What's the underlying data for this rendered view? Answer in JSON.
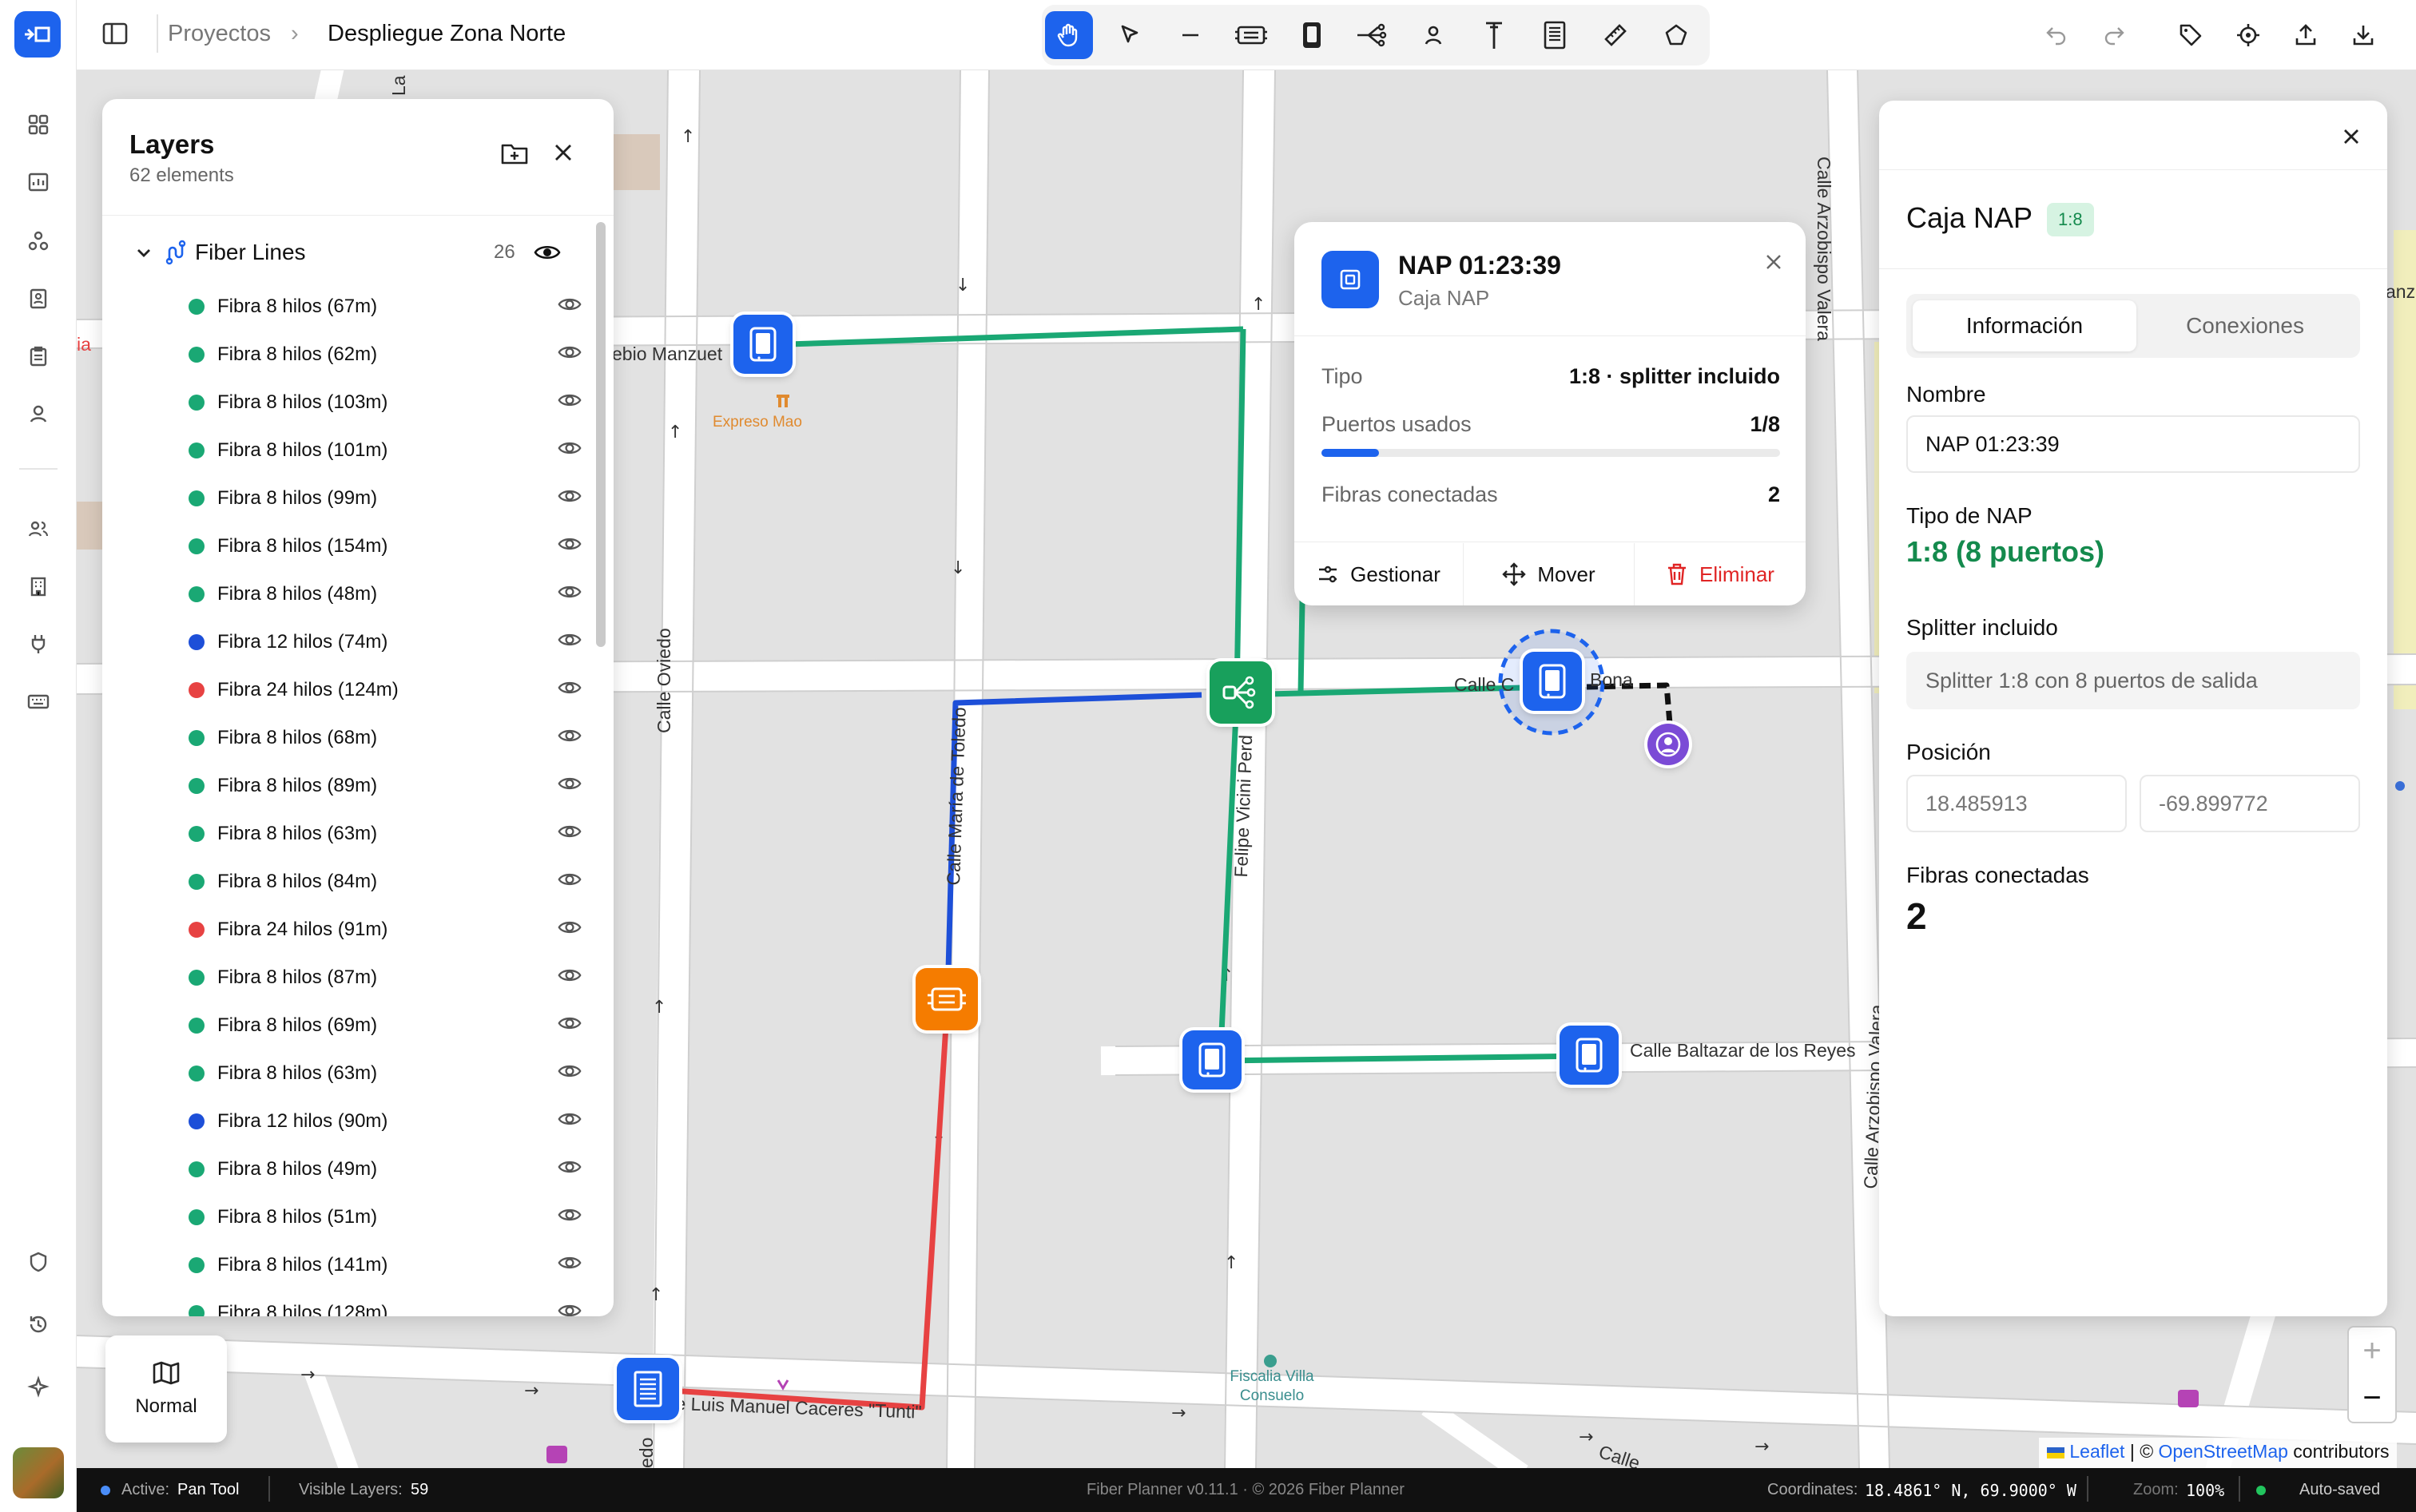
{
  "app": {
    "name": "Fiber Planner"
  },
  "breadcrumb": {
    "parent": "Proyectos",
    "current": "Despliegue Zona Norte"
  },
  "colors": {
    "accent": "#1d63ed",
    "fiber8": "#1aa874",
    "fiber12": "#1d4fd8",
    "fiber24": "#e74242",
    "splitter": "#18a05c",
    "olt": "#f57c00"
  },
  "sidebar": {
    "icons": [
      "dashboard-icon",
      "chart-icon",
      "network-icon",
      "contact-icon",
      "clipboard-icon",
      "user-location-icon",
      "users-icon",
      "building-icon",
      "plug-icon",
      "keyboard-icon",
      "shield-icon",
      "history-icon",
      "sparkle-icon"
    ]
  },
  "toolbar": {
    "tools": [
      "pan-hand-icon",
      "select-pointer-icon",
      "line-icon",
      "olt-icon",
      "nap-box-icon",
      "splitter-icon",
      "client-icon",
      "pole-icon",
      "cabinet-icon",
      "ruler-icon",
      "polygon-icon"
    ],
    "active": "pan-hand-icon",
    "right": [
      "undo-icon",
      "redo-icon",
      "tag-icon",
      "locate-icon",
      "upload-icon",
      "download-icon"
    ]
  },
  "layers": {
    "title": "Layers",
    "subtitle": "62 elements",
    "group": {
      "name": "Fiber Lines",
      "count": "26"
    },
    "items": [
      {
        "label": "Fibra 8 hilos (67m)",
        "color": "#1aa874"
      },
      {
        "label": "Fibra 8 hilos (62m)",
        "color": "#1aa874"
      },
      {
        "label": "Fibra 8 hilos (103m)",
        "color": "#1aa874"
      },
      {
        "label": "Fibra 8 hilos (101m)",
        "color": "#1aa874"
      },
      {
        "label": "Fibra 8 hilos (99m)",
        "color": "#1aa874"
      },
      {
        "label": "Fibra 8 hilos (154m)",
        "color": "#1aa874"
      },
      {
        "label": "Fibra 8 hilos (48m)",
        "color": "#1aa874"
      },
      {
        "label": "Fibra 12 hilos (74m)",
        "color": "#1d4fd8"
      },
      {
        "label": "Fibra 24 hilos (124m)",
        "color": "#e74242"
      },
      {
        "label": "Fibra 8 hilos (68m)",
        "color": "#1aa874"
      },
      {
        "label": "Fibra 8 hilos (89m)",
        "color": "#1aa874"
      },
      {
        "label": "Fibra 8 hilos (63m)",
        "color": "#1aa874"
      },
      {
        "label": "Fibra 8 hilos (84m)",
        "color": "#1aa874"
      },
      {
        "label": "Fibra 24 hilos (91m)",
        "color": "#e74242"
      },
      {
        "label": "Fibra 8 hilos (87m)",
        "color": "#1aa874"
      },
      {
        "label": "Fibra 8 hilos (69m)",
        "color": "#1aa874"
      },
      {
        "label": "Fibra 8 hilos (63m)",
        "color": "#1aa874"
      },
      {
        "label": "Fibra 12 hilos (90m)",
        "color": "#1d4fd8"
      },
      {
        "label": "Fibra 8 hilos (49m)",
        "color": "#1aa874"
      },
      {
        "label": "Fibra 8 hilos (51m)",
        "color": "#1aa874"
      },
      {
        "label": "Fibra 8 hilos (141m)",
        "color": "#1aa874"
      },
      {
        "label": "Fibra 8 hilos (128m)",
        "color": "#1aa874"
      }
    ]
  },
  "popup": {
    "title": "NAP 01:23:39",
    "subtitle": "Caja NAP",
    "type_label": "Tipo",
    "type_value": "1:8 · splitter incluido",
    "ports_label": "Puertos usados",
    "ports_value": "1/8",
    "ports_fraction": 0.125,
    "fibers_label": "Fibras conectadas",
    "fibers_value": "2",
    "btn_manage": "Gestionar",
    "btn_move": "Mover",
    "btn_delete": "Eliminar"
  },
  "details": {
    "title": "Caja NAP",
    "badge": "1:8",
    "tab_info": "Información",
    "tab_connections": "Conexiones",
    "name_label": "Nombre",
    "name_value": "NAP 01:23:39",
    "type_label": "Tipo de NAP",
    "type_value": "1:8 (8 puertos)",
    "splitter_label": "Splitter incluido",
    "splitter_value": "Splitter 1:8 con 8 puertos de salida",
    "position_label": "Posición",
    "lat": "18.485913",
    "lng": "-69.899772",
    "fibers_label": "Fibras conectadas",
    "fibers_value": "2"
  },
  "map": {
    "streets": {
      "s1": "ebio Manzuet",
      "s2": "Calle Oviedo",
      "s3": "Calle María de Toledo",
      "s4": "Felipe Vicini Perd",
      "s5": "Calle C",
      "s6": "ón Bona",
      "s7": "Calle Arzobispo Valera",
      "s8": "Calle Baltazar de los Reyes",
      "s9": "Calle Arzobispo Valera",
      "s10": "e Luis Manuel Caceres \"Tunti\"",
      "s11": "edo",
      "s12": "Calle",
      "s13": "La",
      "s14": "ia",
      "s15": "anz"
    },
    "pois": {
      "restaurant": "Expreso Mao",
      "fiscalia": "Fiscalia Villa Consuelo"
    },
    "basemap_label": "Normal",
    "zoom_in": "+",
    "zoom_out": "−",
    "attribution_leaflet": "Leaflet",
    "attribution_sep": " | © ",
    "attribution_osm": "OpenStreetMap",
    "attribution_tail": " contributors"
  },
  "footer": {
    "active_label": "Active:",
    "active_tool": "Pan Tool",
    "visible_label": "Visible Layers:",
    "visible_count": "59",
    "version": "Fiber Planner v0.11.1 · © 2026 Fiber Planner",
    "coords_label": "Coordinates:",
    "coords_value": "18.4861° N, 69.9000° W",
    "zoom_label": "Zoom:",
    "zoom_value": "100%",
    "save_status": "Auto-saved"
  }
}
